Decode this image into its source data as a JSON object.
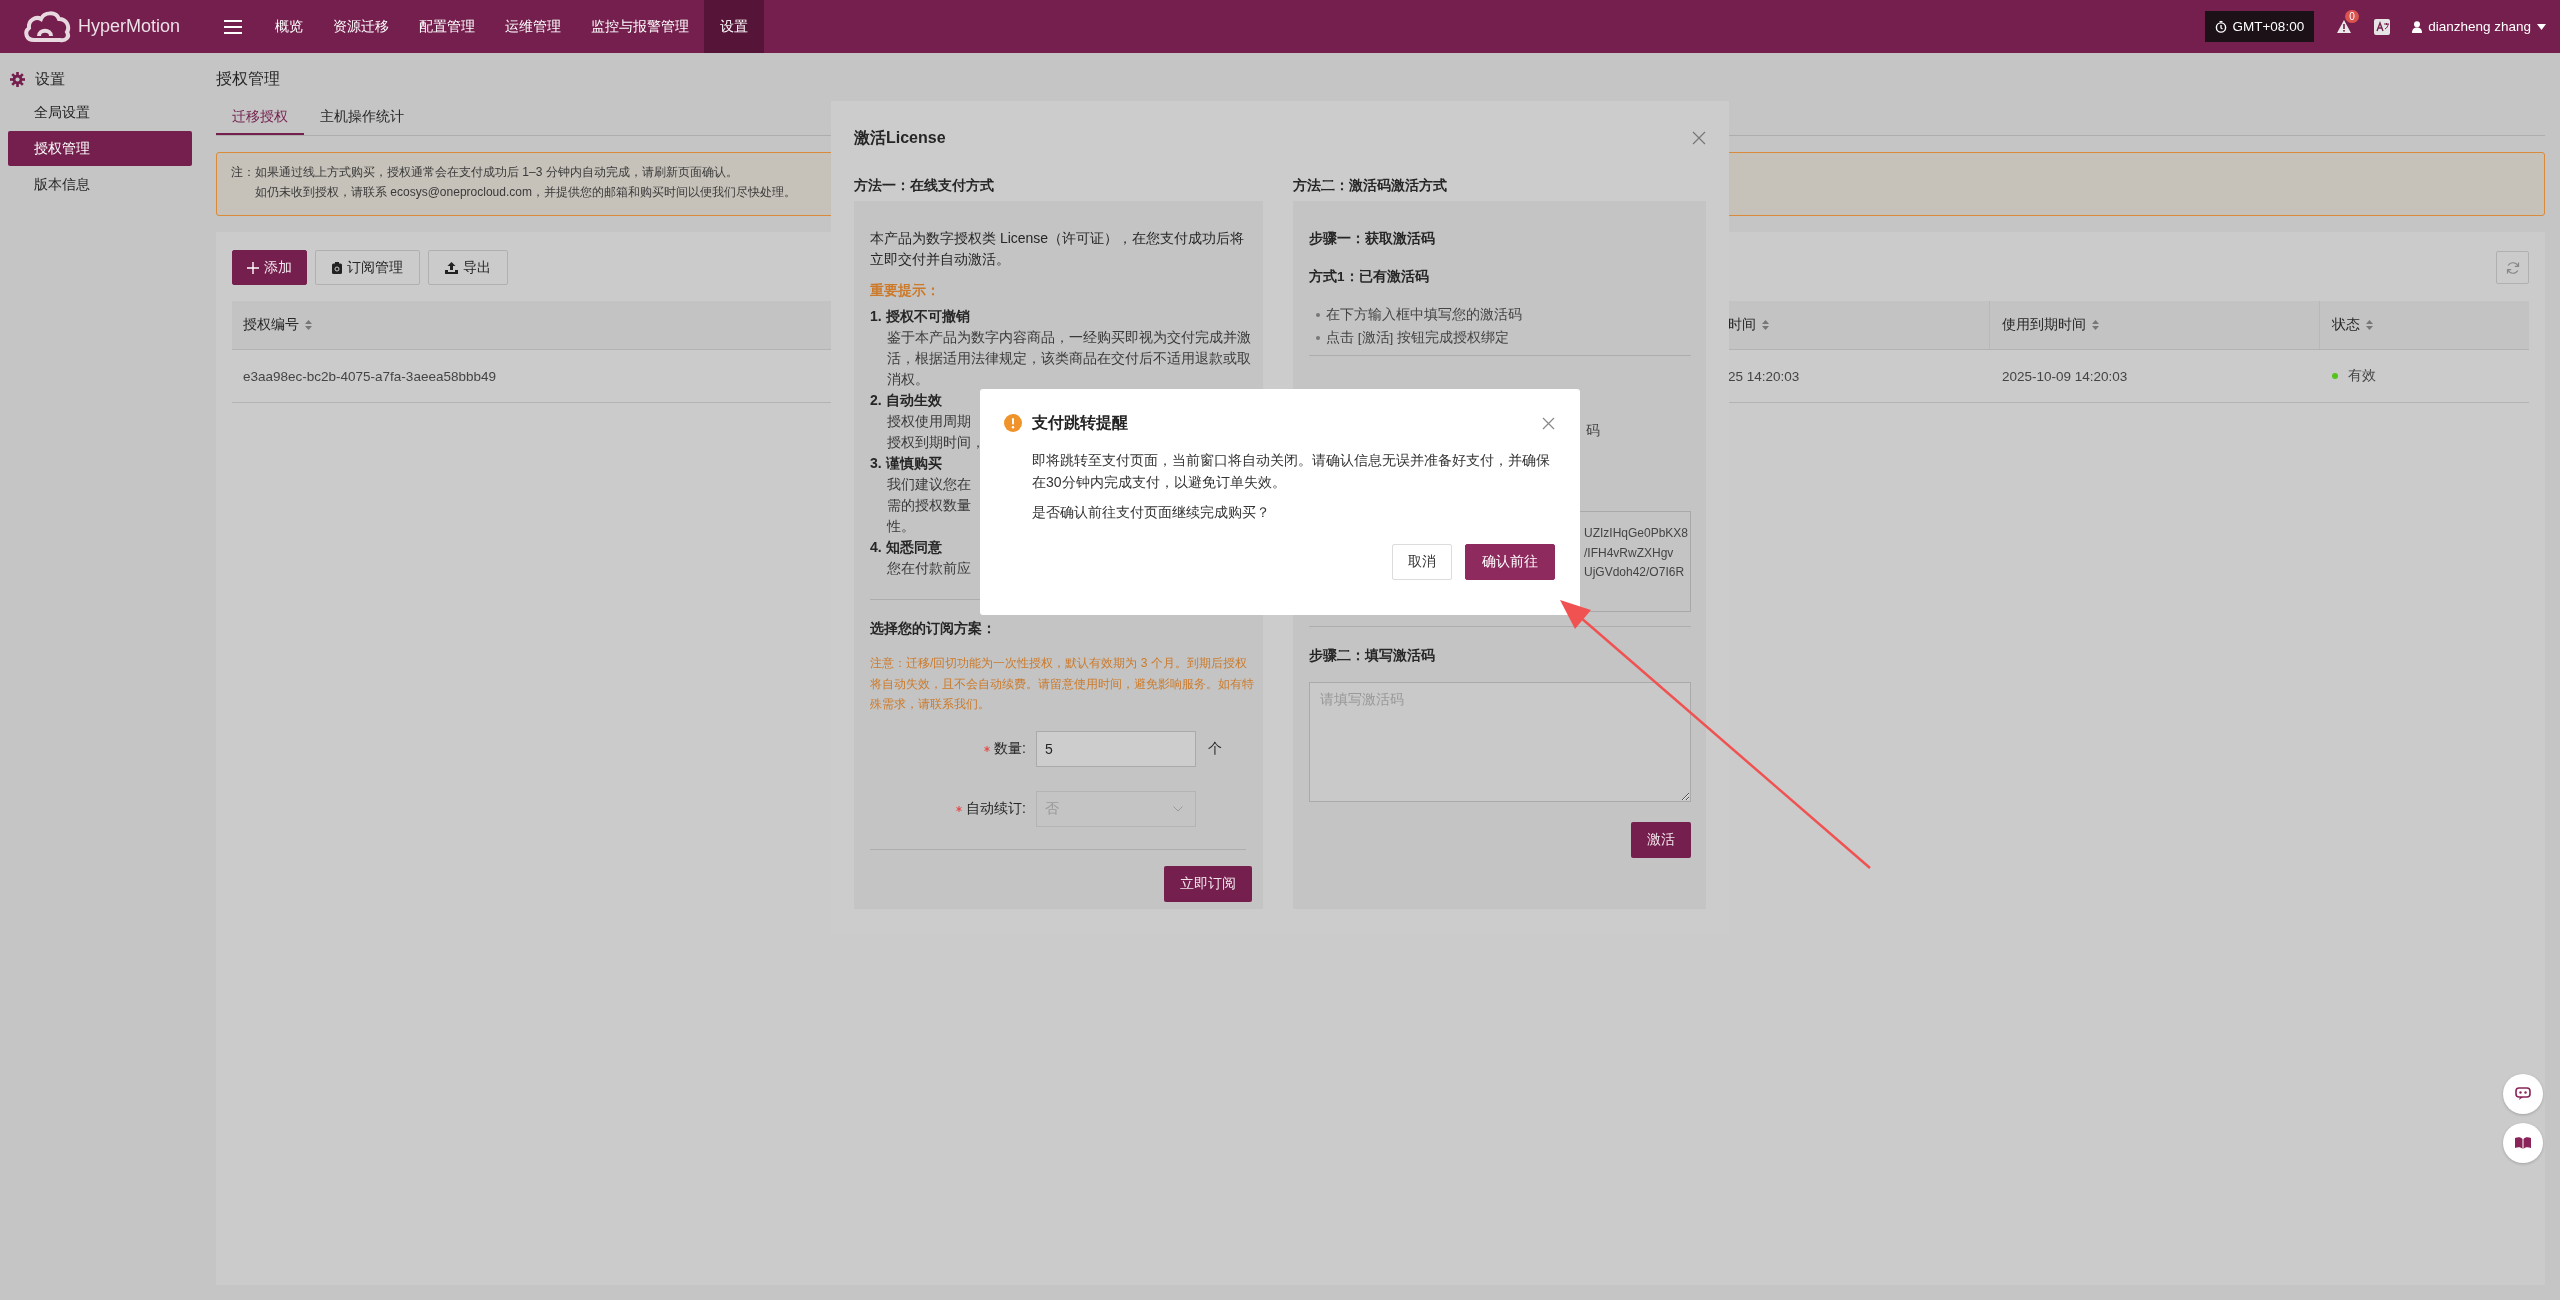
{
  "header": {
    "brand": "HyperMotion",
    "nav": [
      {
        "label": "概览",
        "selected": false
      },
      {
        "label": "资源迁移",
        "selected": false
      },
      {
        "label": "配置管理",
        "selected": false
      },
      {
        "label": "运维管理",
        "selected": false
      },
      {
        "label": "监控与报警管理",
        "selected": false
      },
      {
        "label": "设置",
        "selected": true
      }
    ],
    "timezone": "GMT+08:00",
    "alert_count": "0",
    "user": "dianzheng zhang"
  },
  "sidebar": {
    "title": "设置",
    "items": [
      {
        "label": "全局设置",
        "selected": false
      },
      {
        "label": "授权管理",
        "selected": true
      },
      {
        "label": "版本信息",
        "selected": false
      }
    ]
  },
  "page": {
    "title": "授权管理",
    "tabs": [
      {
        "label": "迁移授权",
        "selected": true
      },
      {
        "label": "主机操作统计",
        "selected": false
      }
    ],
    "notice": [
      "注：如果通过线上方式购买，授权通常会在支付成功后 1–3 分钟内自动完成，请刷新页面确认。",
      "如仍未收到授权，请联系 ecosys@oneprocloud.com，并提供您的邮箱和购买时间以便我们尽快处理。"
    ],
    "toolbar": [
      {
        "label": "添加",
        "kind": "add"
      },
      {
        "label": "订阅管理",
        "kind": "subscription"
      },
      {
        "label": "导出",
        "kind": "export"
      }
    ],
    "table": {
      "columns": [
        {
          "label": "授权编号"
        },
        {
          "label": "时间"
        },
        {
          "label": "使用到期时间"
        },
        {
          "label": "状态"
        }
      ],
      "rows": [
        {
          "cells": [
            "e3aa98ec-bc2b-4075-a7fa-3aeea58bbb49",
            "25 14:20:03",
            "2025-10-09 14:20:03"
          ],
          "status": {
            "label": "有效",
            "color": "#52c41a"
          }
        }
      ]
    }
  },
  "license_dialog": {
    "title": "激活License",
    "method_1": {
      "heading": "方法一：在线支付方式",
      "intro": "本产品为数字授权类 License（许可证），在您支付成功后将立即交付并自动激活。",
      "tips_title": "重要提示：",
      "tips": [
        {
          "title": "1. 授权不可撤销",
          "lines": [
            "鉴于本产品为数字内容商品，一经购买即视为交付完成并激活，根据适用法律规定，该类商品在交付后不适用退款或取消权。"
          ]
        },
        {
          "title": "2. 自动生效",
          "lines": [
            "授权使用周期",
            "授权到期时间，"
          ]
        },
        {
          "title": "3. 谨慎购买",
          "lines": [
            "我们建议您在",
            "需的授权数量",
            "性。"
          ]
        },
        {
          "title": "4. 知悉同意",
          "lines": [
            "您在付款前应"
          ]
        }
      ],
      "plan_title": "选择您的订阅方案：",
      "plan_note": "注意：迁移/回切功能为一次性授权，默认有效期为 3 个月。到期后授权将自动失效，且不会自动续费。请留意使用时间，避免影响服务。如有特殊需求，请联系我们。",
      "quantity": {
        "label": "数量:",
        "required": true,
        "value": "5",
        "unit": "个"
      },
      "auto_renew": {
        "label": "自动续订:",
        "required": true,
        "value": "否",
        "disabled": true
      },
      "submit": "立即订阅"
    },
    "method_2": {
      "heading": "方法二：激活码激活方式",
      "step_1": "步骤一：获取激活码",
      "option_1": "方式1：已有激活码",
      "bullets": [
        "在下方输入框中填写您的激活码",
        "点击 [激活] 按钮完成授权绑定"
      ],
      "fragment": "码",
      "code_lines": [
        "UZIzIHqGe0PbKX8",
        "/IFH4vRwZXHgv",
        "UjGVdoh42/O7I6R"
      ],
      "step_2": "步骤二：填写激活码",
      "placeholder": "请填写激活码",
      "activate": "激活"
    }
  },
  "confirm_dialog": {
    "title": "支付跳转提醒",
    "message": "即将跳转至支付页面，当前窗口将自动关闭。请确认信息无误并准备好支付，并确保在30分钟内完成支付，以避免订单失效。",
    "question": "是否确认前往支付页面继续完成购买？",
    "cancel": "取消",
    "confirm": "确认前往"
  }
}
